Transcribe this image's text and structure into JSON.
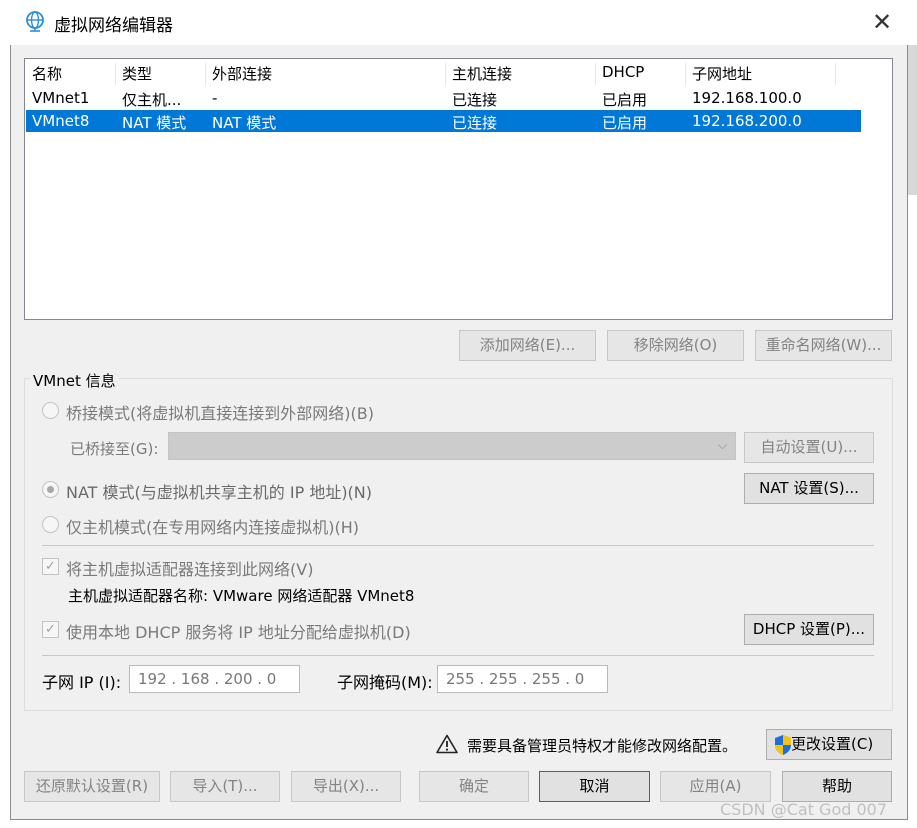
{
  "window": {
    "title": "虚拟网络编辑器",
    "close": "✕"
  },
  "table": {
    "columns": [
      "名称",
      "类型",
      "外部连接",
      "主机连接",
      "DHCP",
      "子网地址"
    ],
    "rows": [
      {
        "name": "VMnet1",
        "type": "仅主机...",
        "external": "-",
        "host": "已连接",
        "dhcp": "已启用",
        "subnet": "192.168.100.0",
        "selected": false
      },
      {
        "name": "VMnet8",
        "type": "NAT 模式",
        "external": "NAT 模式",
        "host": "已连接",
        "dhcp": "已启用",
        "subnet": "192.168.200.0",
        "selected": true
      }
    ]
  },
  "list_buttons": {
    "add": "添加网络(E)...",
    "remove": "移除网络(O)",
    "rename": "重命名网络(W)..."
  },
  "vmnet_info": {
    "group_label": "VMnet 信息",
    "bridged_label": "桥接模式(将虚拟机直接连接到外部网络)(B)",
    "bridged_to_label": "已桥接至(G):",
    "bridged_to_value": "",
    "auto_settings": "自动设置(U)...",
    "nat_label": "NAT 模式(与虚拟机共享主机的 IP 地址)(N)",
    "nat_settings": "NAT 设置(S)...",
    "hostonly_label": "仅主机模式(在专用网络内连接虚拟机)(H)",
    "connect_adapter_label": "将主机虚拟适配器连接到此网络(V)",
    "adapter_name_label": "主机虚拟适配器名称: VMware 网络适配器 VMnet8",
    "dhcp_label": "使用本地 DHCP 服务将 IP 地址分配给虚拟机(D)",
    "dhcp_settings": "DHCP 设置(P)...",
    "subnet_ip_label": "子网 IP (I):",
    "subnet_ip_value": "192 . 168 . 200 .   0",
    "subnet_mask_label": "子网掩码(M):",
    "subnet_mask_value": "255 . 255 . 255 .   0",
    "selected_mode": "nat",
    "connect_adapter_checked": true,
    "dhcp_checked": true
  },
  "admin": {
    "warning": "需要具备管理员特权才能修改网络配置。",
    "change_settings": "更改设置(C)"
  },
  "footer_buttons": {
    "restore": "还原默认设置(R)",
    "import": "导入(T)...",
    "export": "导出(X)...",
    "ok": "确定",
    "cancel": "取消",
    "apply": "应用(A)",
    "help": "帮助"
  },
  "watermark": "CSDN @Cat God 007",
  "colors": {
    "selection": "#0078d7",
    "window_bg": "#f0f0f0",
    "disabled_text": "#838383",
    "shield_blue": "#1e6fd9",
    "shield_yellow": "#f3c413"
  }
}
